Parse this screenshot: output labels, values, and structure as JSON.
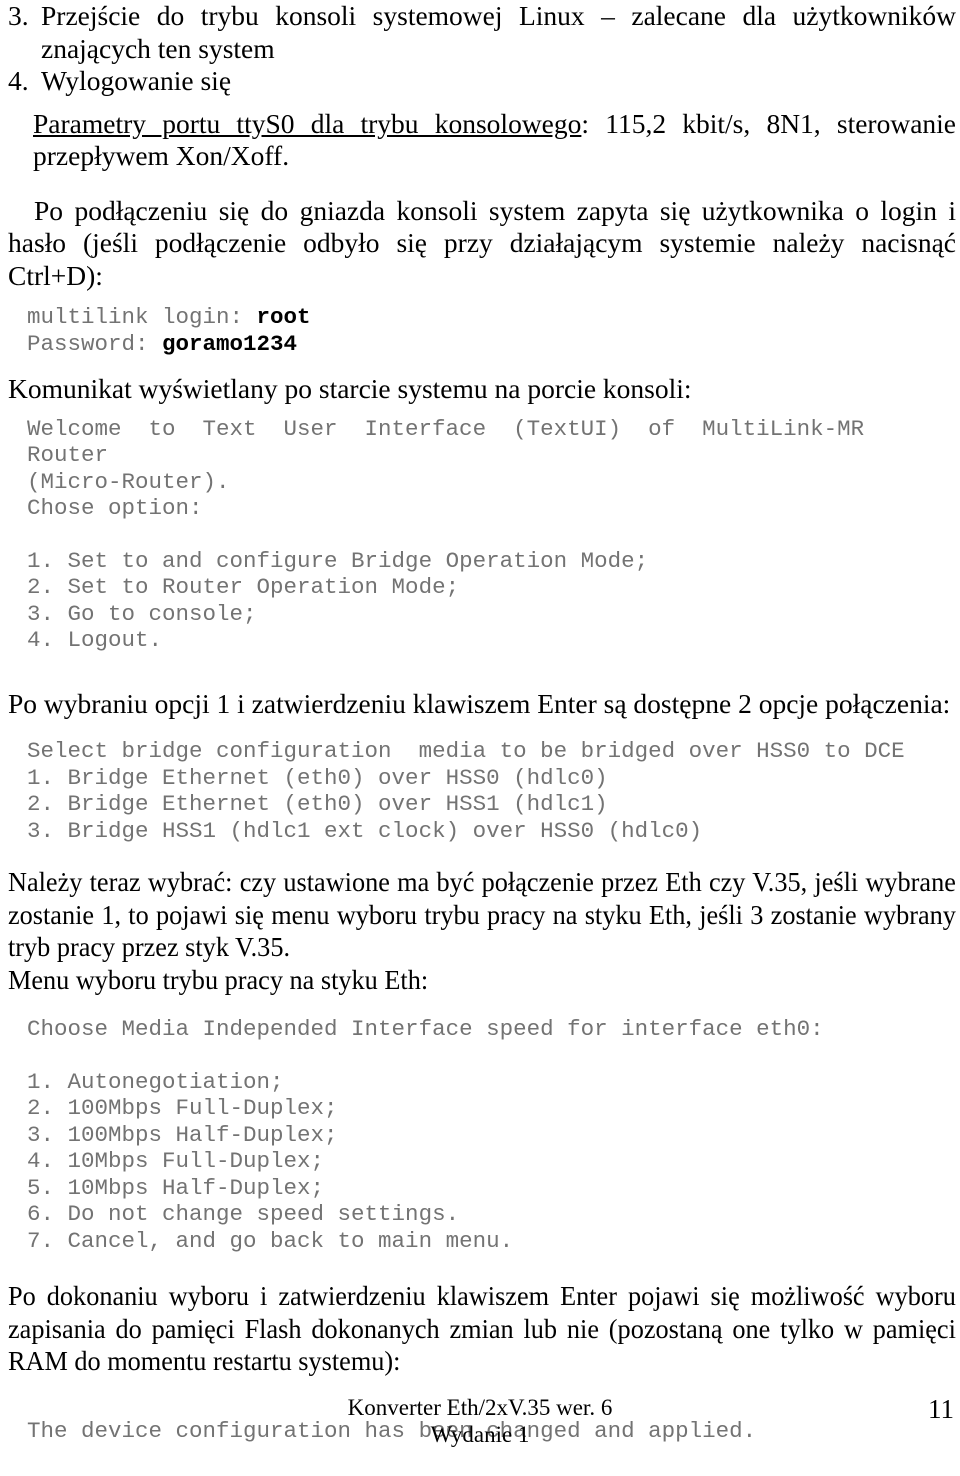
{
  "document": {
    "language": "pl",
    "page_number": "11"
  },
  "outline": {
    "items": [
      {
        "num": "3.",
        "text": "Przejście do trybu konsoli systemowej Linux – zalecane dla użytkowników znających ten system"
      },
      {
        "num": "4.",
        "text": "Wylogowanie się"
      }
    ]
  },
  "params_line": {
    "underlined": "Parametry portu ttyS0 dla trybu konsolowego",
    "rest": ": 115,2 kbit/s, 8N1, sterowanie przepływem Xon/Xoff."
  },
  "paragraphs": {
    "login_intro": "Po podłączeniu się do gniazda konsoli system zapyta się użytkownika o login i hasło (jeśli podłączenie odbyło się przy działającym systemie należy nacisnąć Ctrl+D):",
    "after_option1": "Po wybraniu opcji 1 i zatwierdzeniu klawiszem Enter są dostępne 2 opcje połączenia:",
    "choose_eth_or_v35": "Należy teraz wybrać: czy ustawione ma być połączenie przez Eth czy V.35, jeśli wybrane zostanie 1, to pojawi się menu wyboru trybu pracy na styku Eth, jeśli 3 zostanie wybrany tryb pracy przez styk V.35.",
    "eth_menu_heading": "Menu wyboru trybu pracy na styku Eth:",
    "after_confirm": "Po dokonaniu wyboru i zatwierdzeniu klawiszem Enter pojawi się możliwość wyboru zapisania do pamięci Flash  dokonanych zmian lub nie (pozostaną one tylko w pamięci RAM do momentu restartu systemu):"
  },
  "headings": {
    "boot_message": "Komunikat wyświetlany po starcie systemu na porcie konsoli:"
  },
  "console": {
    "login_prompt_label": "multilink login: ",
    "login_prompt_value": "root",
    "password_label": "Password: ",
    "password_value": "goramo1234",
    "welcome_line": "Welcome to Text User Interface (TextUI) of MultiLink-MR Router",
    "welcome_line2": "(Micro-Router).",
    "chose_option": "Chose option:",
    "main_menu": [
      "1. Set to and configure Bridge Operation Mode;",
      "2. Set to Router Operation Mode;",
      "3. Go to console;",
      "4. Logout."
    ],
    "bridge_header": "Select bridge configuration  media to be bridged over HSS0 to DCE",
    "bridge_menu": [
      "1. Bridge Ethernet (eth0) over HSS0 (hdlc0)",
      "2. Bridge Ethernet (eth0) over HSS1 (hdlc1)",
      "3. Bridge HSS1 (hdlc1 ext clock) over HSS0 (hdlc0)"
    ],
    "mii_header": "Choose Media Independed Interface speed for interface eth0:",
    "mii_menu": [
      "1. Autonegotiation;",
      "2. 100Mbps Full-Duplex;",
      "3. 100Mbps Half-Duplex;",
      "4. 10Mbps Full-Duplex;",
      "5. 10Mbps Half-Duplex;",
      "6. Do not change speed settings.",
      "7. Cancel, and go back to main menu."
    ],
    "applied_message": "The device configuration has been changed and applied."
  },
  "footer": {
    "line1": "Konverter Eth/2xV.35 wer. 6",
    "line2": "Wydanie 1",
    "page": "11"
  },
  "colors": {
    "text": "#000000",
    "console_text": "#737373",
    "console_bold": "#000000",
    "background": "#ffffff"
  }
}
